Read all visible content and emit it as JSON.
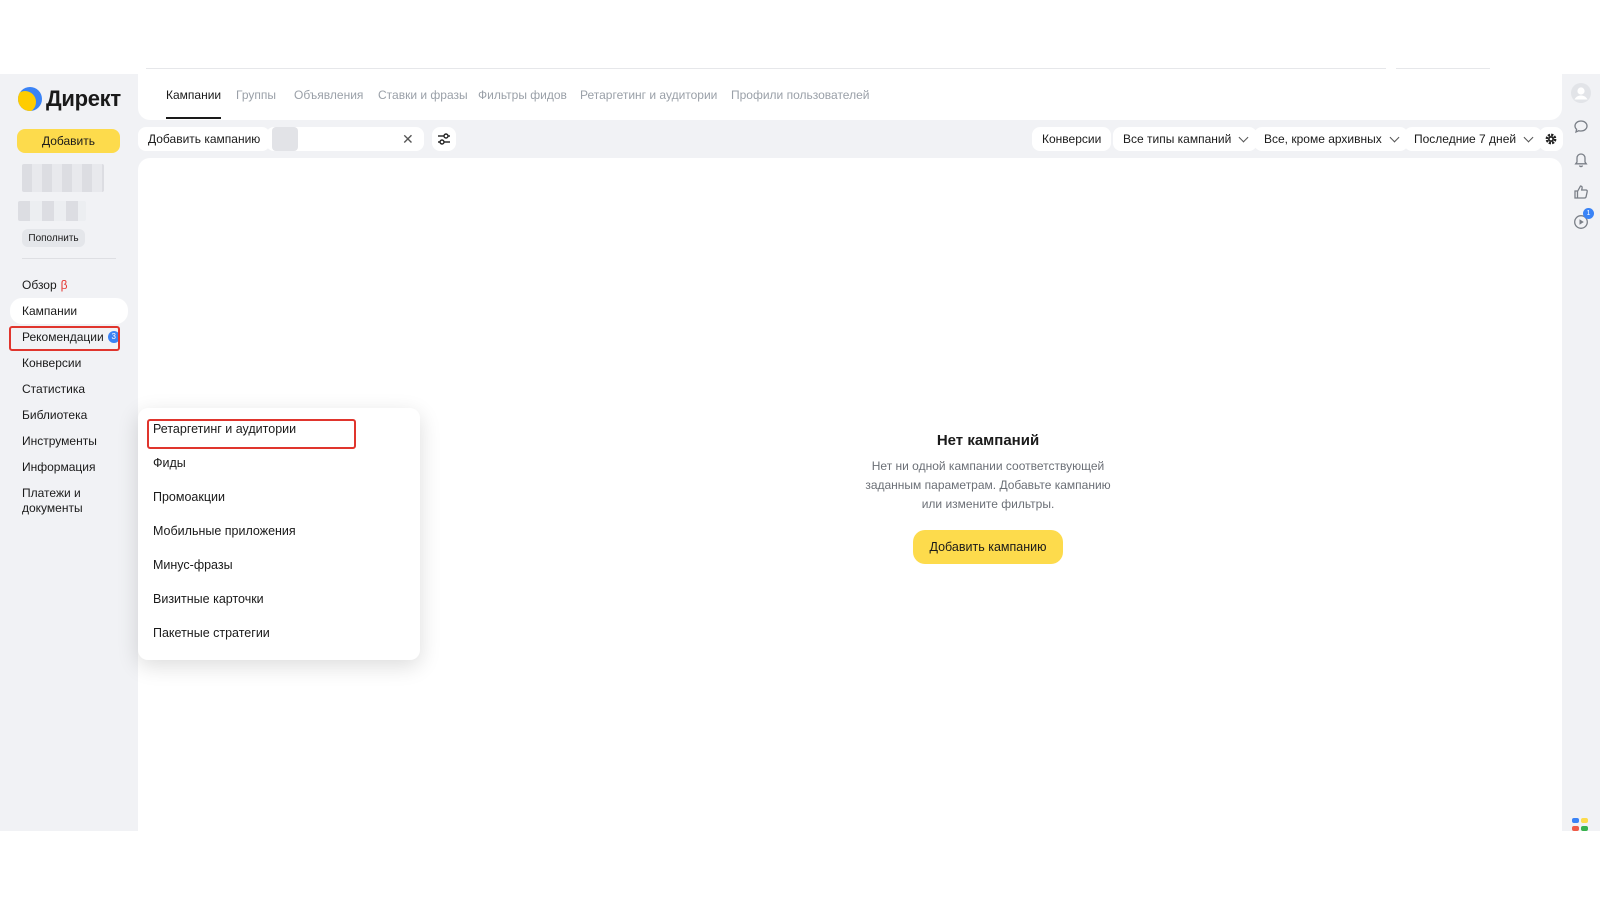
{
  "app": {
    "logo_text": "Директ",
    "add_button": "Добавить",
    "topup_button": "Пополнить"
  },
  "sidebar": {
    "items": [
      {
        "label": "Обзор",
        "beta": "β"
      },
      {
        "label": "Кампании"
      },
      {
        "label": "Рекомендации",
        "badge": "3"
      },
      {
        "label": "Конверсии"
      },
      {
        "label": "Статистика"
      },
      {
        "label": "Библиотека"
      },
      {
        "label": "Инструменты"
      },
      {
        "label": "Информация"
      },
      {
        "label": "Платежи и документы"
      }
    ]
  },
  "tabs": [
    "Кампании",
    "Группы",
    "Объявления",
    "Ставки и фразы",
    "Фильтры фидов",
    "Ретаргетинг и аудитории",
    "Профили пользователей"
  ],
  "toolbar": {
    "add_campaign": "Добавить кампанию",
    "search_value": "",
    "conversions": "Конверсии",
    "campaign_types": "Все типы кампаний",
    "archive_filter": "Все, кроме архивных",
    "period": "Последние 7 дней"
  },
  "empty_state": {
    "title": "Нет кампаний",
    "description": "Нет ни одной кампании соответствующей заданным параметрам. Добавьте кампанию или измените фильтры.",
    "button": "Добавить кампанию"
  },
  "library_menu": {
    "items": [
      "Ретаргетинг и аудитории",
      "Фиды",
      "Промоакции",
      "Мобильные приложения",
      "Минус-фразы",
      "Визитные карточки",
      "Пакетные стратегии"
    ]
  },
  "rail": {
    "video_badge": "1"
  },
  "colors": {
    "accent_yellow": "#fddb4c",
    "highlight_red": "#e0352d",
    "badge_blue": "#3a83f6"
  }
}
